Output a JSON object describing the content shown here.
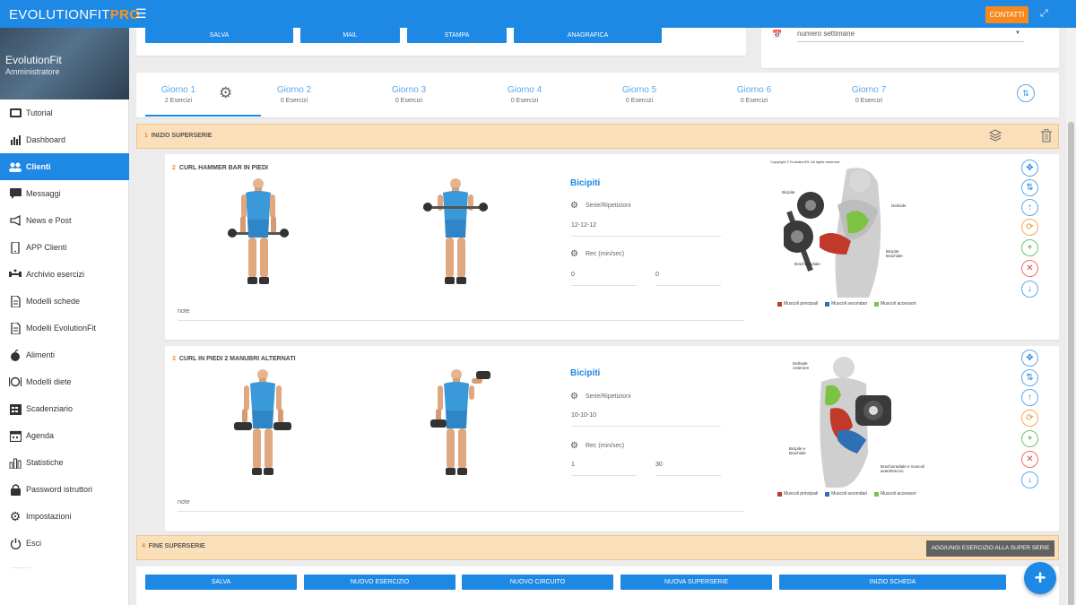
{
  "app": {
    "brand_main": "EVOLUTIONFIT",
    "brand_pro": "PRO",
    "contatti_label": "CONTATTI"
  },
  "sidebar": {
    "user_name": "EvolutionFit",
    "user_role": "Amministratore",
    "items": [
      {
        "label": "Tutorial",
        "icon": "tutorial-icon"
      },
      {
        "label": "Dashboard",
        "icon": "dashboard-icon"
      },
      {
        "label": "Clienti",
        "icon": "clients-icon",
        "active": true
      },
      {
        "label": "Messaggi",
        "icon": "messages-icon"
      },
      {
        "label": "News e Post",
        "icon": "megaphone-icon"
      },
      {
        "label": "APP Clienti",
        "icon": "phone-icon"
      },
      {
        "label": "Archivio esercizi",
        "icon": "dumbbell-icon"
      },
      {
        "label": "Modelli schede",
        "icon": "document-icon"
      },
      {
        "label": "Modelli EvolutionFit",
        "icon": "document-icon"
      },
      {
        "label": "Alimenti",
        "icon": "apple-icon"
      },
      {
        "label": "Modelli diete",
        "icon": "diet-icon"
      },
      {
        "label": "Scadenziario",
        "icon": "calendar-grid-icon"
      },
      {
        "label": "Agenda",
        "icon": "agenda-icon"
      },
      {
        "label": "Statistiche",
        "icon": "stats-icon"
      },
      {
        "label": "Password istruttori",
        "icon": "lock-icon"
      },
      {
        "label": "Impostazioni",
        "icon": "gear-icon"
      },
      {
        "label": "Esci",
        "icon": "power-icon"
      }
    ]
  },
  "top_actions": {
    "salva": "SALVA",
    "mail": "MAIL",
    "stampa": "STAMPA",
    "anagrafica": "ANAGRAFICA"
  },
  "weeks_select": {
    "value": "numero settimane"
  },
  "days": [
    {
      "label": "Giorno 1",
      "sub": "2 Esercizi"
    },
    {
      "label": "Giorno 2",
      "sub": "0 Esercizi"
    },
    {
      "label": "Giorno 3",
      "sub": "0 Esercizi"
    },
    {
      "label": "Giorno 4",
      "sub": "0 Esercizi"
    },
    {
      "label": "Giorno 5",
      "sub": "0 Esercizi"
    },
    {
      "label": "Giorno 6",
      "sub": "0 Esercizi"
    },
    {
      "label": "Giorno 7",
      "sub": "0 Esercizi"
    }
  ],
  "superset_start": {
    "num": "1",
    "label": "INIZIO SUPERSERIE"
  },
  "superset_end": {
    "num": "4",
    "label": "FINE SUPERSERIE",
    "add_label": "AGGIUNGI ESERCIZIO ALLA SUPER SERIE"
  },
  "exercises": [
    {
      "num": "2",
      "name": "CURL HAMMER BAR IN PIEDI",
      "muscle": "Bicipiti",
      "sets_label": "Serie/Ripetizioni",
      "sets_value": "12-12-12",
      "rec_label": "Rec (min/sec)",
      "rec_min": "0",
      "rec_sec": "0",
      "note": "note",
      "anatomy_labels": [
        "Bicipite",
        "Deltoide",
        "Bicipite Brachiale",
        "Brachioradiale"
      ]
    },
    {
      "num": "3",
      "name": "CURL IN PIEDI 2 MANUBRI ALTERNATI",
      "muscle": "Bicipiti",
      "sets_label": "Serie/Ripetizioni",
      "sets_value": "10-10-10",
      "rec_label": "Rec (min/sec)",
      "rec_min": "1",
      "rec_sec": "30",
      "note": "note",
      "anatomy_labels": [
        "Deltoide Anteriore",
        "Bicipite e Brachiale",
        "Brachioradiale e muscoli avambraccio"
      ]
    }
  ],
  "anatomy": {
    "copyright": "Copyright © EvolutionFit. All rights reserved.",
    "legend": [
      "Muscoli principali",
      "Muscoli secondari",
      "Muscoli accessori"
    ],
    "colors": {
      "primary": "#c0392b",
      "secondary": "#2f6fb5",
      "accessory": "#7cc243"
    }
  },
  "bottom_actions": {
    "salva": "SALVA",
    "nuovo_esercizio": "NUOVO ESERCIZIO",
    "nuovo_circuito": "NUOVO CIRCUITO",
    "nuova_superserie": "NUOVA SUPERSERIE",
    "inizio_scheda": "INIZIO SCHEDA"
  },
  "fab_label": "+",
  "sidebar_more": "................"
}
